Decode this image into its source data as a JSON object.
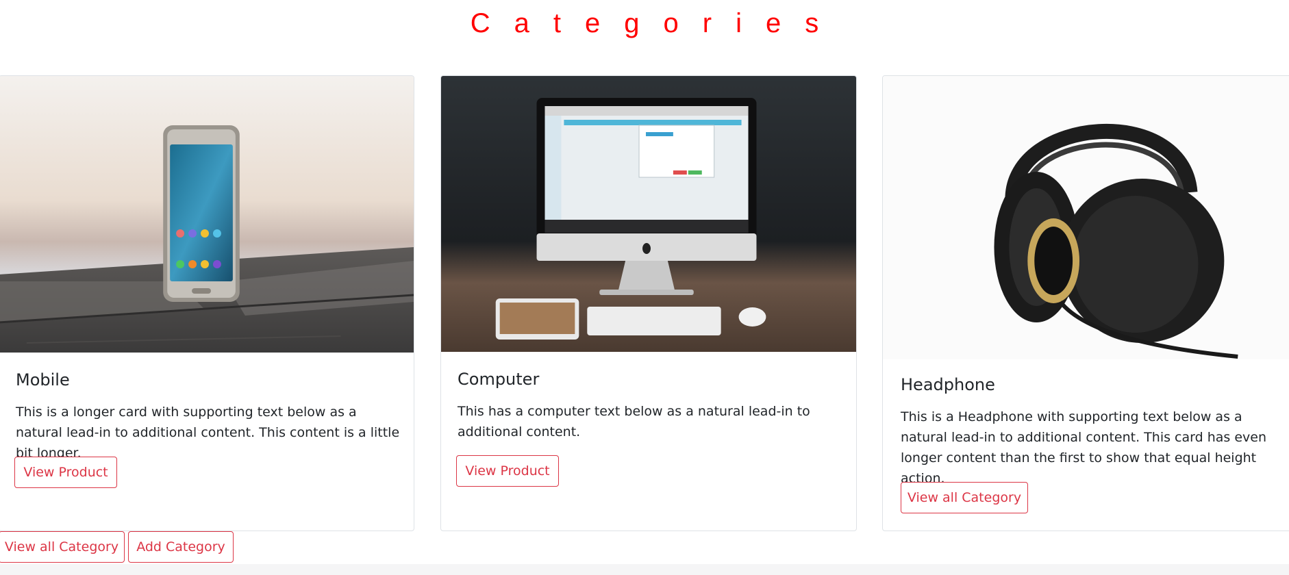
{
  "page": {
    "heading": "Categories"
  },
  "cards": [
    {
      "title": "Mobile",
      "text": "This is a longer card with supporting text below as a natural lead-in to additional content. This content is a little bit longer.",
      "button": "View Product",
      "image_icon": "smartphone-photo"
    },
    {
      "title": "Computer",
      "text": "This has a computer text below as a natural lead-in to additional content.",
      "button": "View Product",
      "image_icon": "desktop-computer-photo"
    },
    {
      "title": "Headphone",
      "text": "This is a Headphone with supporting text below as a natural lead-in to additional content. This card has even longer content than the first to show that equal height action.",
      "button": "View all Category",
      "image_icon": "headphones-photo"
    }
  ],
  "actions": {
    "view_all": "View all Category",
    "add": "Add Category"
  },
  "colors": {
    "heading": "#ff0000",
    "button": "#dc3545",
    "border": "#dee2e6"
  }
}
